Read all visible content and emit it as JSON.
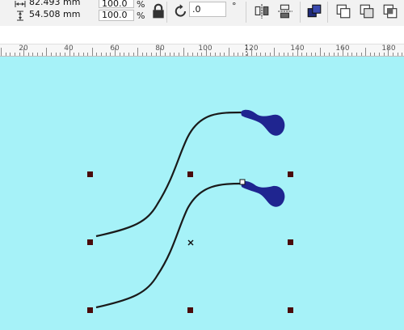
{
  "toolbar": {
    "width_value": "82.493 mm",
    "height_value": "54.508 mm",
    "scale_x": "100.0",
    "scale_y": "100.0",
    "percent_symbol": "%",
    "rotation_value": ".0",
    "degree_symbol": "°"
  },
  "ruler": {
    "labels": [
      "20",
      "40",
      "60",
      "80",
      "100",
      "120",
      "140",
      "160",
      "180"
    ]
  },
  "canvas": {
    "background_color": "#a6f2f8",
    "curve_color": "#1a1a1a",
    "blob_color": "#1f2590",
    "handle_color": "#4a0a0a"
  }
}
